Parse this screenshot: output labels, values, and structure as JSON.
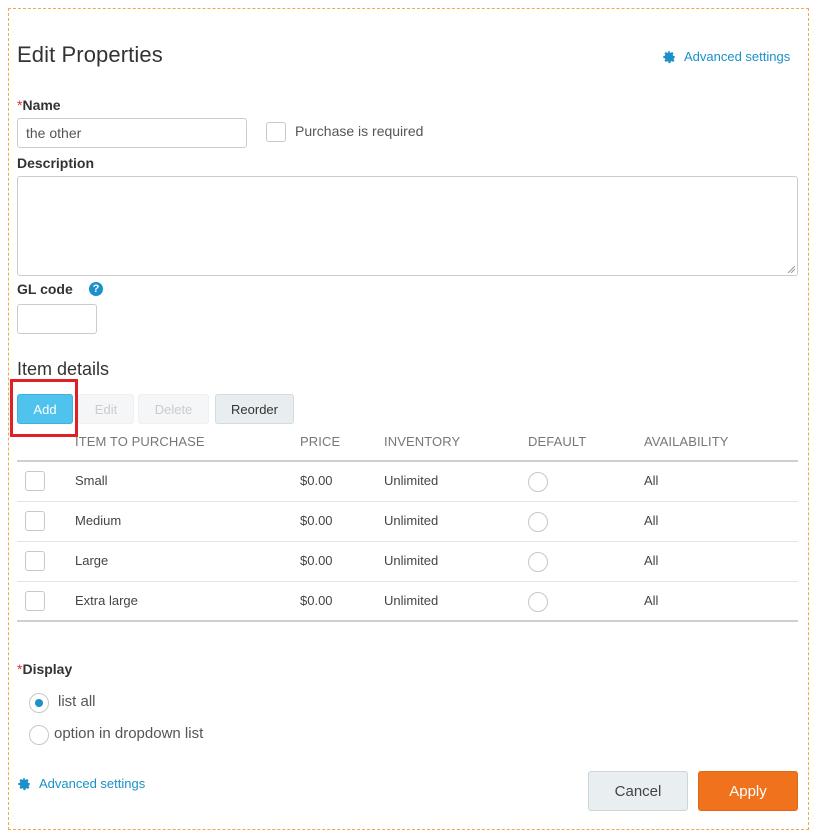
{
  "header": {
    "title": "Edit Properties",
    "advanced_settings_label": "Advanced settings"
  },
  "form": {
    "name_required_mark": "*",
    "name_label": "Name",
    "name_value": "the other",
    "purchase_required_label": "Purchase is required",
    "purchase_required_checked": false,
    "description_label": "Description",
    "description_value": "",
    "gl_code_label": "GL code",
    "gl_code_value": ""
  },
  "items": {
    "section_title": "Item details",
    "toolbar": {
      "add_label": "Add",
      "edit_label": "Edit",
      "delete_label": "Delete",
      "reorder_label": "Reorder"
    },
    "columns": [
      "ITEM TO PURCHASE",
      "PRICE",
      "INVENTORY",
      "DEFAULT",
      "AVAILABILITY"
    ],
    "rows": [
      {
        "name": "Small",
        "price": "$0.00",
        "inventory": "Unlimited",
        "availability": "All"
      },
      {
        "name": "Medium",
        "price": "$0.00",
        "inventory": "Unlimited",
        "availability": "All"
      },
      {
        "name": "Large",
        "price": "$0.00",
        "inventory": "Unlimited",
        "availability": "All"
      },
      {
        "name": "Extra large",
        "price": "$0.00",
        "inventory": "Unlimited",
        "availability": "All"
      }
    ]
  },
  "display": {
    "required_mark": "*",
    "label": "Display",
    "options": [
      "list all",
      "option in dropdown list"
    ],
    "selected": "list all"
  },
  "footer": {
    "advanced_settings_label": "Advanced settings",
    "cancel_label": "Cancel",
    "apply_label": "Apply"
  },
  "colors": {
    "accent": "#1a91c9",
    "add_button": "#4fc3ed",
    "apply_button": "#f0721c",
    "highlight": "#e02027",
    "frame_border": "#f0a848"
  },
  "icons": {
    "advanced_settings": "gear-icon",
    "gl_code_help": "question-icon"
  }
}
